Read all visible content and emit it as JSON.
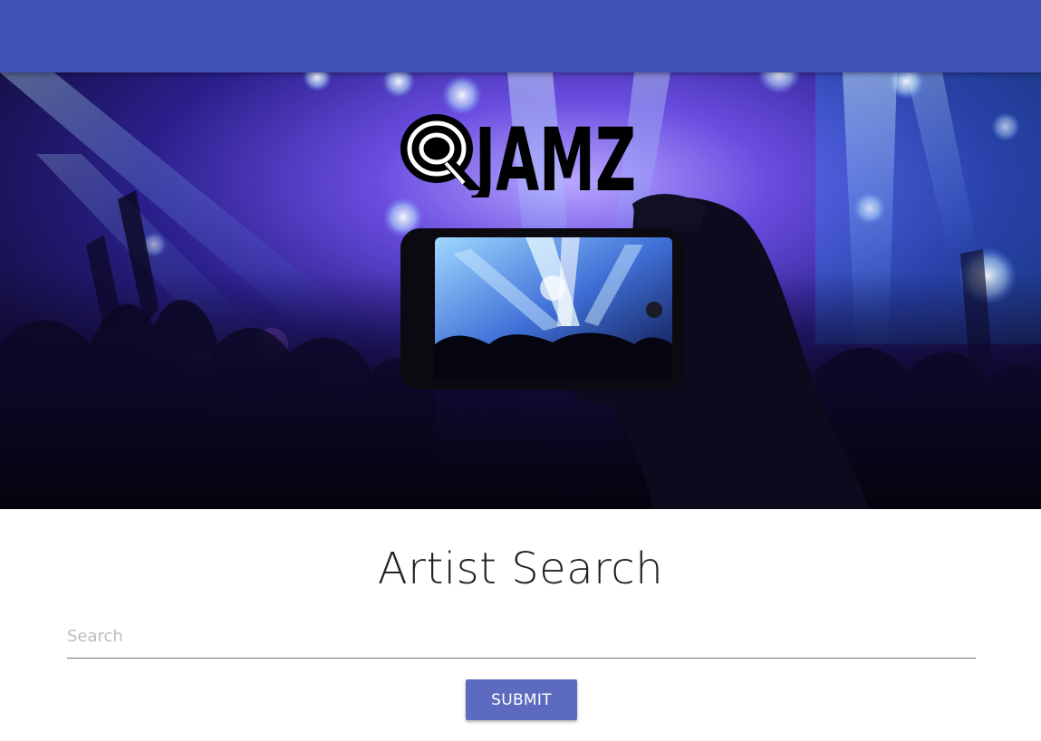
{
  "app_bar": {
    "color": "#3f51b5"
  },
  "hero": {
    "description_icon": "concert-phone-photo",
    "logo": {
      "text": "JAMZ",
      "mark": "Q"
    }
  },
  "main": {
    "title": "Artist Search",
    "search": {
      "placeholder": "Search",
      "value": ""
    },
    "submit_label": "SUBMIT",
    "accent_color": "#5c6bc0"
  }
}
